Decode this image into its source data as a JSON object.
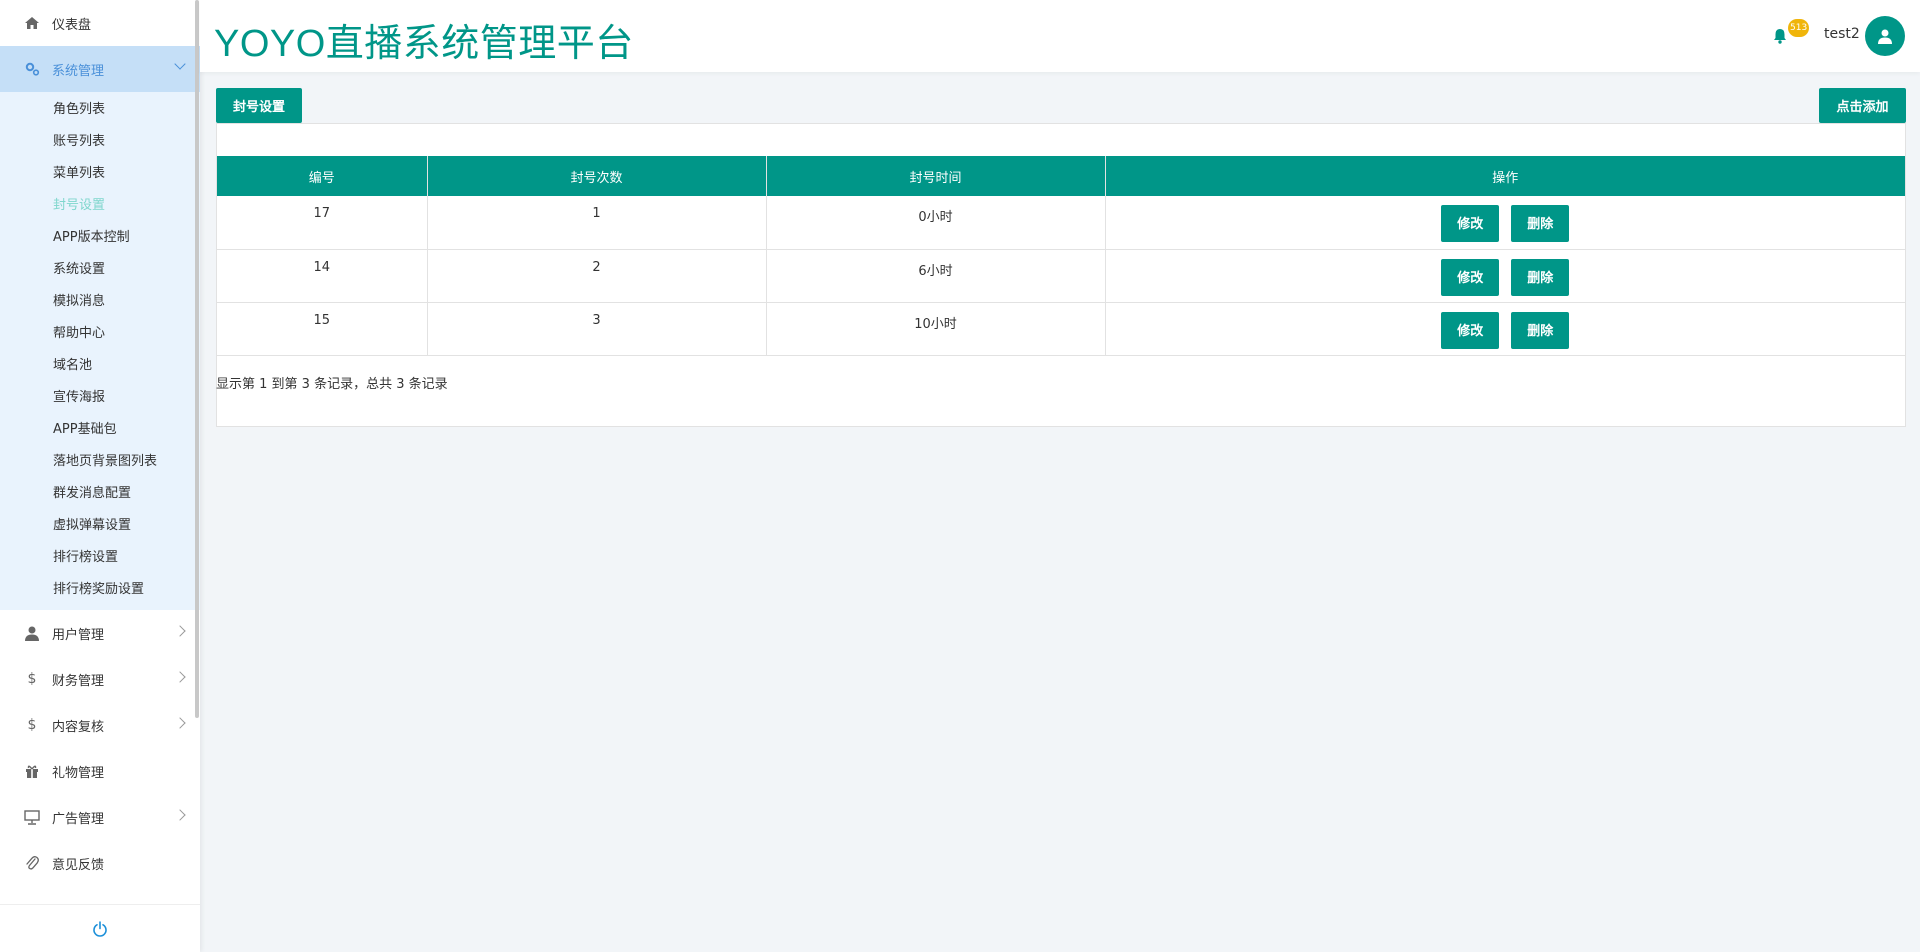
{
  "header": {
    "title": "YOYO直播系统管理平台",
    "notification_count": "513",
    "username": "test2"
  },
  "sidebar": {
    "items": [
      {
        "label": "仪表盘",
        "icon": "home-icon"
      },
      {
        "label": "系统管理",
        "icon": "cogs-icon"
      },
      {
        "label": "用户管理",
        "icon": "user-icon"
      },
      {
        "label": "财务管理",
        "icon": "dollar-icon"
      },
      {
        "label": "内容复核",
        "icon": "dollar-icon"
      },
      {
        "label": "礼物管理",
        "icon": "gift-icon"
      },
      {
        "label": "广告管理",
        "icon": "monitor-icon"
      },
      {
        "label": "意见反馈",
        "icon": "paperclip-icon"
      }
    ],
    "submenu": [
      "角色列表",
      "账号列表",
      "菜单列表",
      "封号设置",
      "APP版本控制",
      "系统设置",
      "模拟消息",
      "帮助中心",
      "域名池",
      "宣传海报",
      "APP基础包",
      "落地页背景图列表",
      "群发消息配置",
      "虚拟弹幕设置",
      "排行榜设置",
      "排行榜奖励设置"
    ]
  },
  "main": {
    "tab_label": "封号设置",
    "add_label": "点击添加",
    "table": {
      "headers": [
        "编号",
        "封号次数",
        "封号时间",
        "操作"
      ],
      "rows": [
        {
          "id": "17",
          "count": "1",
          "time": "0小时"
        },
        {
          "id": "14",
          "count": "2",
          "time": "6小时"
        },
        {
          "id": "15",
          "count": "3",
          "time": "10小时"
        }
      ],
      "edit_label": "修改",
      "delete_label": "删除"
    },
    "summary": "显示第 1 到第 3 条记录，总共 3 条记录"
  },
  "colors": {
    "primary": "#009688",
    "active_menu_bg": "#c5dff7",
    "submenu_bg": "#e9f3fd",
    "active_sub_text": "#7fd6cd",
    "badge": "#f0b50b"
  }
}
